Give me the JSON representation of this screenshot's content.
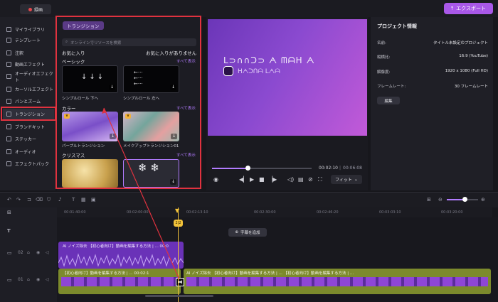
{
  "topbar": {
    "record_label": "録画",
    "export_label": "エクスポート"
  },
  "sidebar": {
    "items": [
      {
        "label": "マイライブラリ",
        "icon": "library-icon"
      },
      {
        "label": "テンプレート",
        "icon": "template-icon"
      },
      {
        "label": "注釈",
        "icon": "annotation-icon"
      },
      {
        "label": "動画エフェクト",
        "icon": "video-effect-icon"
      },
      {
        "label": "オーディオエフェクト",
        "icon": "audio-effect-icon"
      },
      {
        "label": "カーソルエフェクト",
        "icon": "cursor-effect-icon"
      },
      {
        "label": "パンとズーム",
        "icon": "pan-zoom-icon"
      },
      {
        "label": "トランジション",
        "icon": "transition-icon"
      },
      {
        "label": "ブランドキット",
        "icon": "brand-kit-icon"
      },
      {
        "label": "ステッカー",
        "icon": "sticker-icon"
      },
      {
        "label": "オーディオ",
        "icon": "audio-icon"
      },
      {
        "label": "エフェクトパック",
        "icon": "effect-pack-icon"
      }
    ]
  },
  "panel": {
    "title": "トランジション",
    "search_placeholder": "オンラインでリソースを検索",
    "favorites_label": "お気に入り",
    "favorites_empty": "お気に入りがありません",
    "sections": [
      {
        "label": "ベーシック",
        "see_all": "すべて表示",
        "items": [
          "シンプルロール 下へ",
          "シンプルロール 左へ"
        ]
      },
      {
        "label": "カラー",
        "see_all": "すべて表示",
        "items": [
          "パープルトランジション",
          "メイクアップトランジション01"
        ]
      },
      {
        "label": "クリスマス",
        "see_all": "すべて表示",
        "items": [
          "",
          ""
        ]
      }
    ]
  },
  "player": {
    "time_current": "00:02:10",
    "time_total": "00:06:08",
    "fit_label": "フィット"
  },
  "info": {
    "title": "プロジェクト情報",
    "rows": [
      {
        "k": "名前:",
        "v": "タイトル未設定のプロジェクト"
      },
      {
        "k": "縦横比:",
        "v": "16:9 (YouTube)"
      },
      {
        "k": "解像度:",
        "v": "1920 x 1080 (Full HD)"
      },
      {
        "k": "フレームレート:",
        "v": "30 フレームレート"
      }
    ],
    "edit_label": "編集"
  },
  "timeline": {
    "ticks": [
      "00:01:40:00",
      "00:02:00:00",
      "00:02:13:10",
      "00:02:30:00",
      "00:02:46:20",
      "00:03:03:10",
      "00:03:20:00"
    ],
    "playhead_label": "2|2",
    "add_caption": "字幕を追加",
    "upper_clip": "AI ノイズ除去  【初心者向け】動画を編集する方法 | ...  00:0",
    "main_clip_a": "【初心者向け】動画を編集する方法 | ...  00:02:1",
    "main_clip_b": "AI ノイズ除去  【初心者向け】動画を編集する方法 | ...  【初心者向け】動画を編集する方法 | ...",
    "track_upper": "02",
    "track_main": "01"
  }
}
